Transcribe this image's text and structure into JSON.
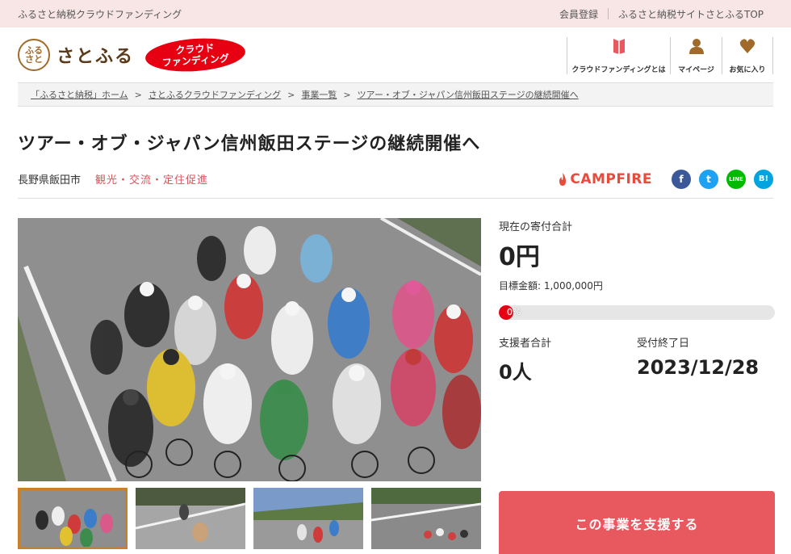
{
  "topbar": {
    "tagline": "ふるさと納税クラウドファンディング",
    "register": "会員登録",
    "site_top": "ふるさと納税サイトさとふるTOP"
  },
  "header": {
    "logo_mark": "ふる\nさと",
    "logo_text": "さとふる",
    "badge_line1": "クラウド",
    "badge_line2": "ファンディング",
    "nav": [
      {
        "label": "クラウドファンディングとは",
        "icon": "book-icon"
      },
      {
        "label": "マイページ",
        "icon": "user-icon"
      },
      {
        "label": "お気に入り",
        "icon": "heart-icon"
      }
    ]
  },
  "breadcrumb": [
    "「ふるさと納税」ホーム",
    "さとふるクラウドファンディング",
    "事業一覧",
    "ツアー・オブ・ジャパン信州飯田ステージの継続開催へ"
  ],
  "project": {
    "title": "ツアー・オブ・ジャパン信州飯田ステージの継続開催へ",
    "location": "長野県飯田市",
    "category": "観光・交流・定住促進",
    "partner": "CAMPFIRE"
  },
  "social": [
    {
      "name": "facebook-icon",
      "glyph": "f",
      "color": "#3b5998"
    },
    {
      "name": "twitter-icon",
      "glyph": "t",
      "color": "#1da1f2"
    },
    {
      "name": "line-icon",
      "glyph": "LINE",
      "color": "#00b900"
    },
    {
      "name": "hatena-icon",
      "glyph": "B!",
      "color": "#00a4de"
    }
  ],
  "funding": {
    "current_label": "現在の寄付合計",
    "current_amount": "0円",
    "target_label": "目標金額: 1,000,000円",
    "progress_text": "0%",
    "progress_percent": 0,
    "supporters_label": "支援者合計",
    "supporters_value": "0人",
    "deadline_label": "受付終了日",
    "deadline_value": "2023/12/28",
    "cta": "この事業を支援する"
  },
  "colors": {
    "accent": "#e8585f",
    "brand_red": "#e60012",
    "category": "#d9545e"
  }
}
